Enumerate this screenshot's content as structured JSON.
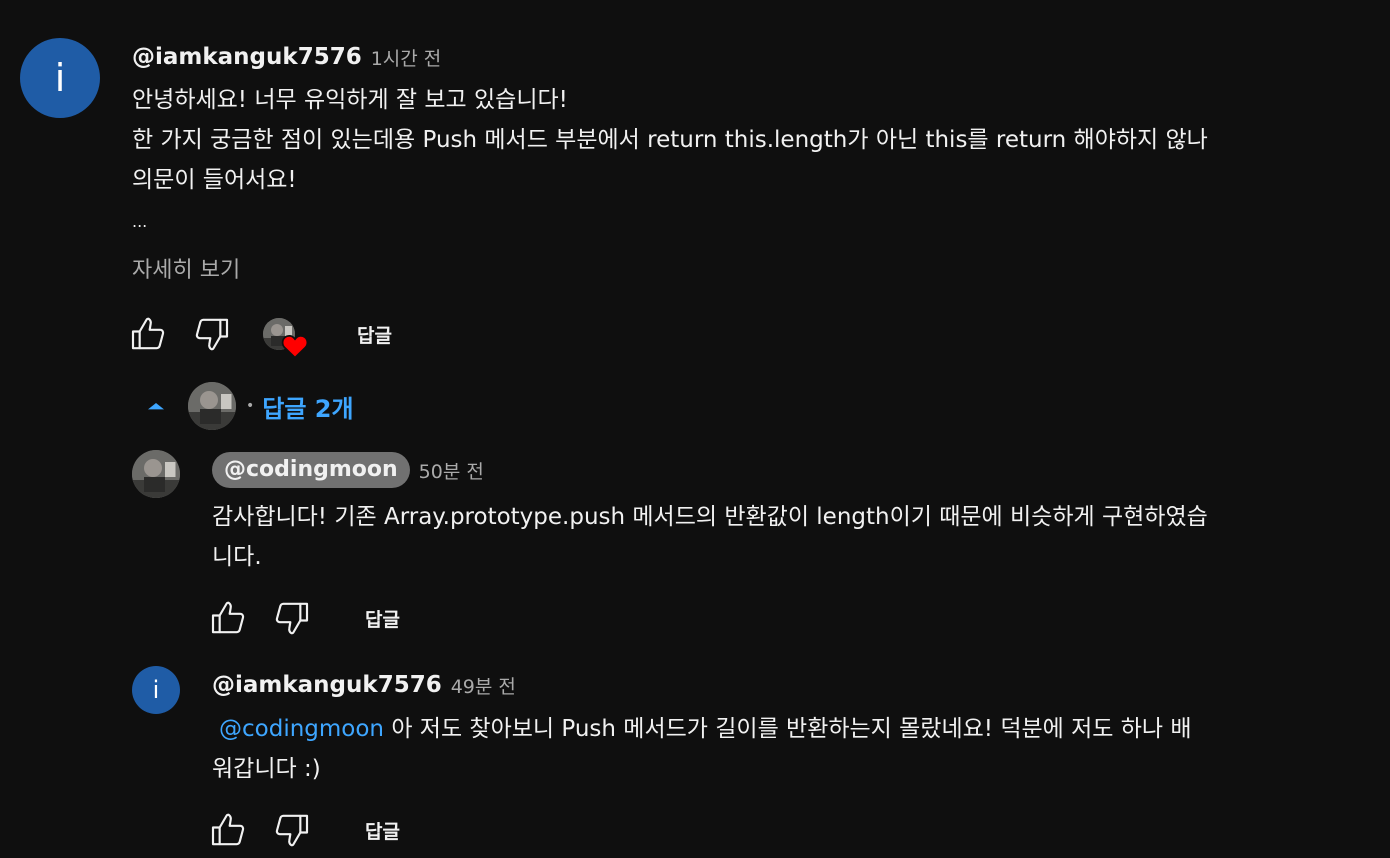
{
  "comment": {
    "avatar_letter": "i",
    "author": "@iamkanguk7576",
    "time": "1시간 전",
    "lines": [
      "안녕하세요! 너무 유익하게 잘 보고 있습니다!",
      "한 가지 궁금한 점이 있는데용 Push 메서드 부분에서 return this.length가 아닌 this를 return 해야하지 않나",
      "의문이 들어서요!"
    ],
    "ellipsis": "...",
    "read_more": "자세히 보기",
    "reply_label": "답글",
    "creator_heart": true
  },
  "replies_toggle": {
    "label": "답글 2개",
    "dot": "•",
    "expanded": true
  },
  "replies": [
    {
      "author": "@codingmoon",
      "is_creator": true,
      "time": "50분 전",
      "lines": [
        "감사합니다! 기존 Array.prototype.push 메서드의 반환값이 length이기 때문에 비슷하게 구현하였습",
        "니다."
      ],
      "reply_label": "답글"
    },
    {
      "avatar_letter": "i",
      "author": "@iamkanguk7576",
      "time": "49분 전",
      "mention": "@codingmoon",
      "line1_rest": " 아 저도 찾아보니 Push 메서드가 길이를 반환하는지 몰랐네요! 덕분에 저도 하나 배",
      "line2": "워갑니다 :)",
      "reply_label": "답글"
    }
  ],
  "colors": {
    "background": "#0f0f0f",
    "text": "#f1f1f1",
    "secondary": "#aaaaaa",
    "link_blue": "#3ea6ff",
    "avatar_blue": "#1f5ca6",
    "creator_pill": "#717171",
    "heart_red": "#ff0000"
  },
  "icons": [
    "thumbs-up-icon",
    "thumbs-down-icon",
    "heart-icon",
    "chevron-up-icon"
  ]
}
